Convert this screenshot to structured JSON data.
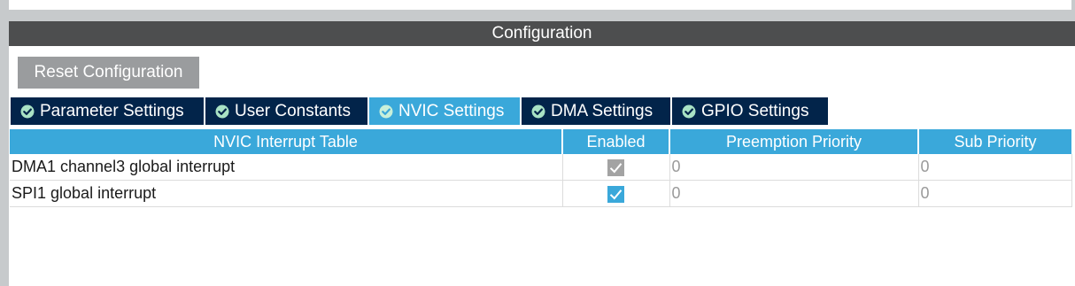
{
  "header": {
    "title": "Configuration"
  },
  "toolbar": {
    "reset_label": "Reset Configuration"
  },
  "tabs": [
    {
      "label": "Parameter Settings",
      "icon": "check-circle-icon",
      "active": false
    },
    {
      "label": "User Constants",
      "icon": "check-circle-icon",
      "active": false
    },
    {
      "label": "NVIC Settings",
      "icon": "check-circle-icon",
      "active": true
    },
    {
      "label": "DMA Settings",
      "icon": "check-circle-icon",
      "active": false
    },
    {
      "label": "GPIO Settings",
      "icon": "check-circle-icon",
      "active": false
    }
  ],
  "table": {
    "columns": [
      "NVIC Interrupt Table",
      "Enabled",
      "Preemption Priority",
      "Sub Priority"
    ],
    "rows": [
      {
        "name": "DMA1 channel3 global interrupt",
        "enabled": true,
        "enabled_editable": false,
        "preemption": "0",
        "sub": "0"
      },
      {
        "name": "SPI1 global interrupt",
        "enabled": true,
        "enabled_editable": true,
        "preemption": "0",
        "sub": "0"
      }
    ]
  },
  "colors": {
    "header_bg": "#4d4e4f",
    "tab_bg": "#02244a",
    "accent": "#3aa8da",
    "button_bg": "#9a9c9e"
  }
}
